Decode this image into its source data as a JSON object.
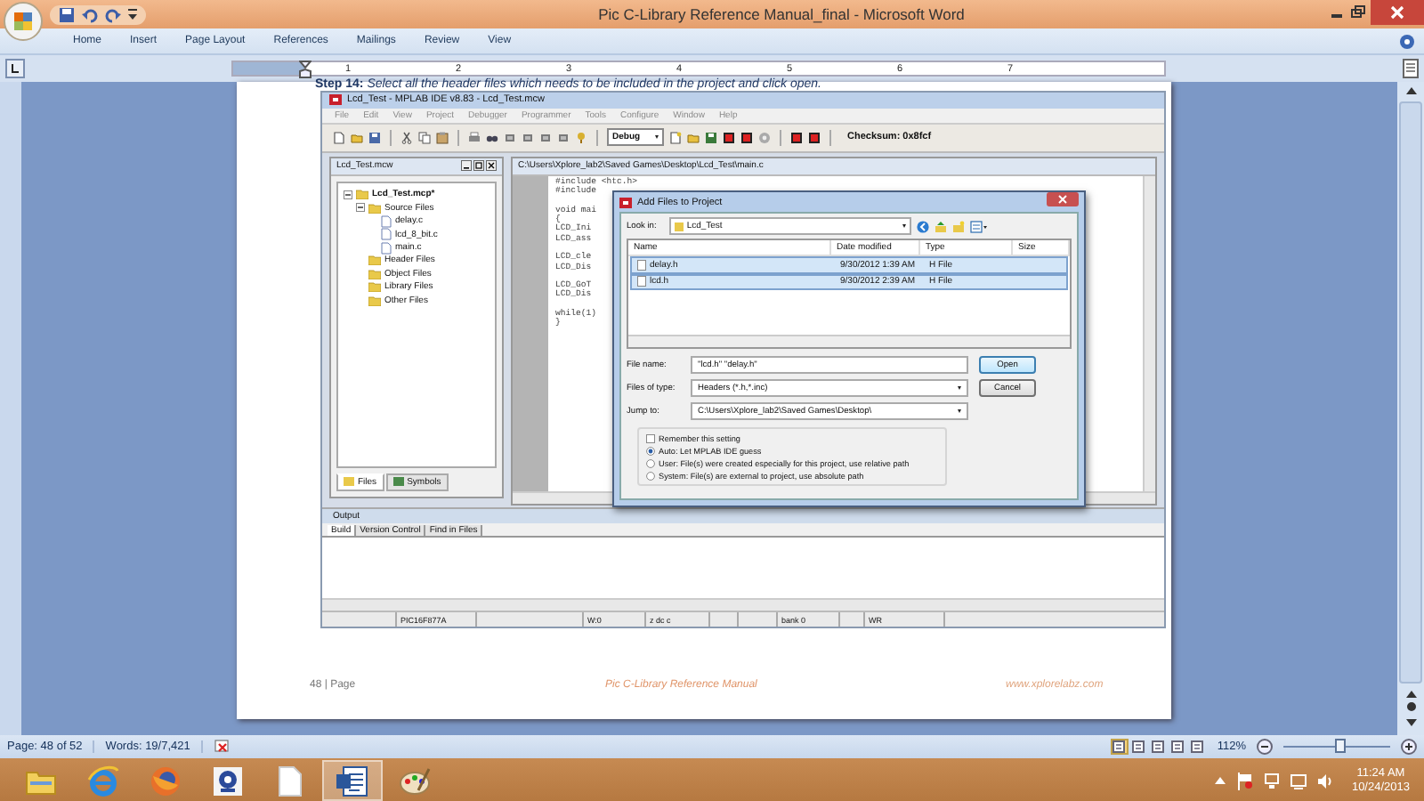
{
  "window": {
    "title": "Pic C-Library Reference Manual_final - Microsoft Word"
  },
  "ribbon_tabs": [
    "Home",
    "Insert",
    "Page Layout",
    "References",
    "Mailings",
    "Review",
    "View"
  ],
  "ruler": {
    "numbers": [
      "1",
      "2",
      "3",
      "4",
      "5",
      "6",
      "7"
    ]
  },
  "page": {
    "step_text": "**Step 14:** *Select all the header files which needs to be included in the project and click open.*",
    "footer": {
      "page": "48 | Page",
      "title": "Pic C-Library Reference Manual",
      "site": "www.xplorelabz.com"
    }
  },
  "mplab": {
    "title": "Lcd_Test - MPLAB IDE v8.83 - Lcd_Test.mcw",
    "menu": [
      "File",
      "Edit",
      "View",
      "Project",
      "Debugger",
      "Programmer",
      "Tools",
      "Configure",
      "Window",
      "Help"
    ],
    "config": "Debug",
    "checksum": "Checksum:  0x8fcf",
    "workspace": {
      "title": "Lcd_Test.mcw",
      "tree": [
        {
          "label": "Lcd_Test.mcp*",
          "expanded": true,
          "children": [
            {
              "label": "Source Files",
              "expanded": true,
              "children": [
                {
                  "label": "delay.c"
                },
                {
                  "label": "lcd_8_bit.c"
                },
                {
                  "label": "main.c"
                }
              ]
            },
            {
              "label": "Header Files"
            },
            {
              "label": "Object Files"
            },
            {
              "label": "Library Files"
            },
            {
              "label": "Other Files"
            }
          ]
        }
      ],
      "tabs": [
        {
          "label": "Files",
          "selected": true
        },
        {
          "label": "Symbols",
          "selected": false
        }
      ]
    },
    "editor": {
      "title": "C:\\Users\\Xplore_lab2\\Saved Games\\Desktop\\Lcd_Test\\main.c",
      "code_blocks": [
        [
          "#include <htc.h>",
          "#include"
        ],
        [
          "void mai",
          "{",
          "LCD_Ini",
          "LCD_ass"
        ],
        [
          "LCD_cle",
          "LCD_Dis"
        ],
        [
          "LCD_GoT",
          "LCD_Dis"
        ],
        [
          "while(1)",
          "}"
        ]
      ]
    },
    "output": {
      "title": "Output",
      "tabs": [
        {
          "label": "Build",
          "selected": true
        },
        {
          "label": "Version Control",
          "selected": false
        },
        {
          "label": "Find in Files",
          "selected": false
        }
      ],
      "status_cells": [
        "PIC16F877A",
        "W:0",
        "z dc c",
        "bank 0",
        "WR"
      ]
    }
  },
  "dialog": {
    "title": "Add Files to Project",
    "look_in_label": "Look in:",
    "look_in": "Lcd_Test",
    "columns": [
      "Name",
      "Date modified",
      "Type",
      "Size"
    ],
    "files": [
      {
        "name": "delay.h",
        "date": "9/30/2012 1:39 AM",
        "type": "H File",
        "selected": true
      },
      {
        "name": "lcd.h",
        "date": "9/30/2012 2:39 AM",
        "type": "H File",
        "selected": true
      }
    ],
    "fields": [
      {
        "label": "File name:",
        "value": "\"lcd.h\" \"delay.h\"",
        "kind": "text"
      },
      {
        "label": "Files of type:",
        "value": "Headers (*.h,*.inc)",
        "kind": "dropdown"
      },
      {
        "label": "Jump to:",
        "value": "C:\\Users\\Xplore_lab2\\Saved Games\\Desktop\\",
        "kind": "dropdown"
      }
    ],
    "buttons": [
      "Open",
      "Cancel"
    ],
    "remember": {
      "label": "Remember this setting",
      "checked": false
    },
    "path_options": [
      {
        "label": "Auto: Let MPLAB IDE guess",
        "selected": true
      },
      {
        "label": "User: File(s) were created especially for this project, use relative path",
        "selected": false
      },
      {
        "label": "System: File(s) are external to project, use absolute path",
        "selected": false
      }
    ]
  },
  "status_bar": {
    "page": "Page: 48 of 52",
    "words": "Words: 19/7,421",
    "views": [
      {
        "selected": true
      },
      {
        "selected": false
      },
      {
        "selected": false
      },
      {
        "selected": false
      },
      {
        "selected": false
      }
    ],
    "zoom": "112%",
    "zoom_slider": {
      "level": 0.53
    }
  },
  "taskbar": {
    "apps": [
      {
        "kind": "folder",
        "selected": false
      },
      {
        "kind": "ie",
        "selected": false
      },
      {
        "kind": "firefox",
        "selected": false
      },
      {
        "kind": "webcam",
        "selected": false
      },
      {
        "kind": "document",
        "selected": false
      },
      {
        "kind": "word",
        "selected": true
      },
      {
        "kind": "paint",
        "selected": false
      }
    ],
    "time": "11:24 AM",
    "date": "10/24/2013"
  }
}
